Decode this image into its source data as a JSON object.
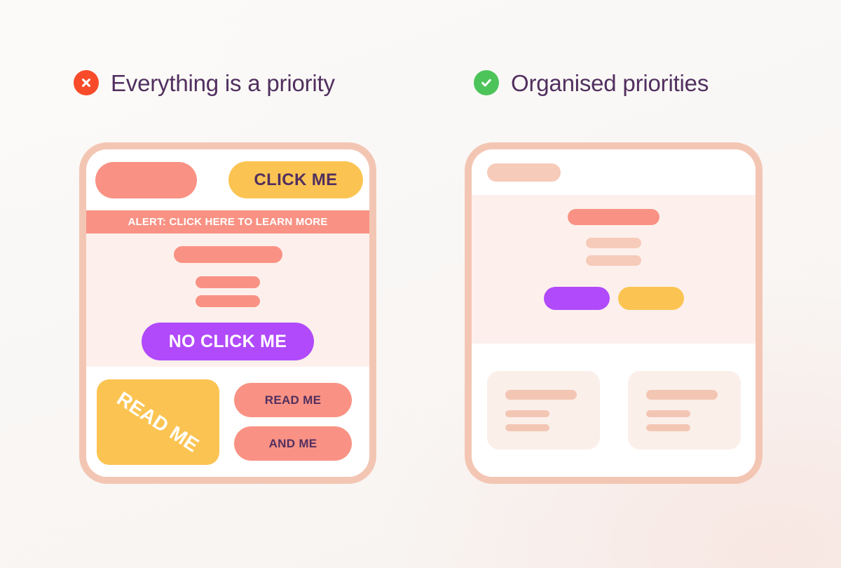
{
  "theme": {
    "background": "#FAF8F6",
    "heading_text_color": "#512F5F",
    "error_icon_color": "#F84B2A",
    "success_icon_color": "#4CC45A",
    "card_border_color": "#F3C6B4",
    "coral": "#F99284",
    "coral_light": "#F6CBBA",
    "amber": "#FBC452",
    "purple": "#B14AFB",
    "body_tint": "#FDF0EC",
    "panel_white": "#FFFFFF"
  },
  "panels": {
    "bad": {
      "heading": "Everything is a priority",
      "icon": "circle-x-icon",
      "header": {
        "logo_placeholder": "",
        "cta_label": "CLICK ME"
      },
      "alert": {
        "text": "ALERT: CLICK HERE TO LEARN MORE"
      },
      "body": {
        "skeleton_lines": [
          "",
          "",
          ""
        ],
        "cta_label": "NO CLICK ME"
      },
      "footer": {
        "tile_label": "READ ME",
        "buttons": [
          "READ ME",
          "AND ME"
        ]
      }
    },
    "good": {
      "heading": "Organised priorities",
      "icon": "circle-check-icon",
      "header": {
        "logo_placeholder": ""
      },
      "body": {
        "skeleton_lines": [
          "",
          "",
          ""
        ],
        "buttons": [
          "",
          ""
        ]
      },
      "footer": {
        "cards": [
          {
            "lines": [
              "",
              "",
              ""
            ]
          },
          {
            "lines": [
              "",
              "",
              ""
            ]
          }
        ]
      }
    }
  }
}
